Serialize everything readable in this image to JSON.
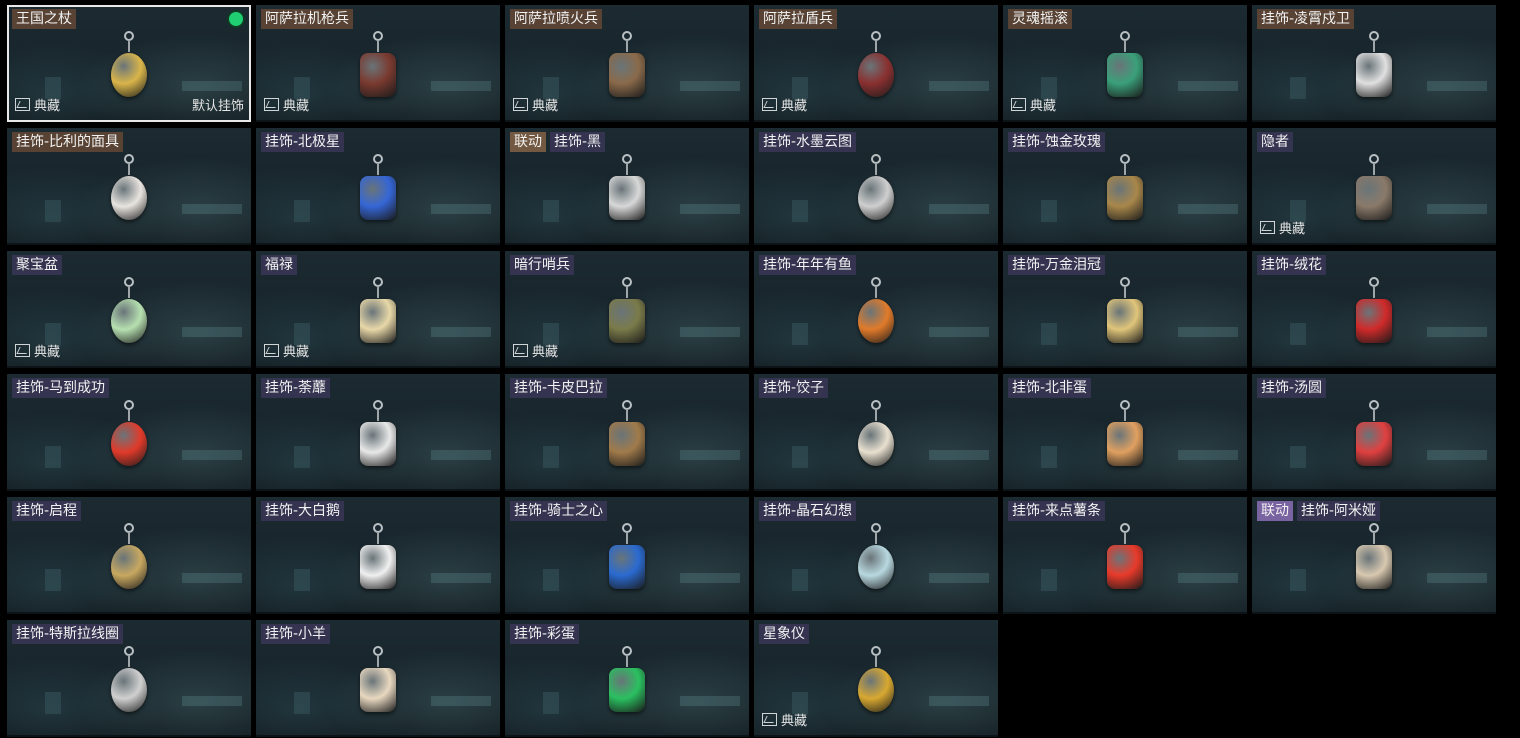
{
  "charms": [
    {
      "name": "王国之杖",
      "name_style": "orange",
      "collection": "典藏",
      "default_label": "默认挂饰",
      "selected": true,
      "equipped": true,
      "icon": "golden-castle-scepter",
      "color": "#d9b54a"
    },
    {
      "name": "阿萨拉机枪兵",
      "name_style": "orange",
      "collection": "典藏",
      "icon": "machine-gunner-figure",
      "color": "#7a3a30"
    },
    {
      "name": "阿萨拉喷火兵",
      "name_style": "orange",
      "collection": "典藏",
      "icon": "flamethrower-figure",
      "color": "#8a6a4a"
    },
    {
      "name": "阿萨拉盾兵",
      "name_style": "orange",
      "collection": "典藏",
      "icon": "shield-soldier-figure",
      "color": "#8a3030"
    },
    {
      "name": "灵魂摇滚",
      "name_style": "orange",
      "collection": "典藏",
      "icon": "rock-guitarist-figure",
      "color": "#3aa07a"
    },
    {
      "name": "挂饰-凌霄戍卫",
      "name_style": "orange",
      "icon": "rocket-charm",
      "color": "#e0e0e0"
    },
    {
      "name": "挂饰-比利的面具",
      "name_style": "orange",
      "icon": "billy-mask-charm",
      "color": "#e8e4df"
    },
    {
      "name": "挂饰-北极星",
      "name_style": "purple",
      "icon": "polaris-blade-charm",
      "color": "#3566d6"
    },
    {
      "name": "挂饰-黑",
      "name_style": "purple",
      "link_tag": "联动",
      "link_style": "orange",
      "icon": "black-lighter-charm",
      "color": "#d8d8d8"
    },
    {
      "name": "挂饰-水墨云图",
      "name_style": "purple",
      "icon": "ink-cloud-ball-charm",
      "color": "#cfcfcf"
    },
    {
      "name": "挂饰-蚀金玫瑰",
      "name_style": "purple",
      "icon": "gold-rose-badge-charm",
      "color": "#a8874a"
    },
    {
      "name": "隐者",
      "name_style": "purple",
      "collection": "典藏",
      "icon": "hermit-card-charm",
      "color": "#8a7a6a"
    },
    {
      "name": "聚宝盆",
      "name_style": "purple",
      "collection": "典藏",
      "icon": "treasure-bowl-charm",
      "color": "#b6e0b0"
    },
    {
      "name": "福禄",
      "name_style": "purple",
      "collection": "典藏",
      "icon": "gourd-charm",
      "color": "#e8d8a8"
    },
    {
      "name": "暗行哨兵",
      "name_style": "purple",
      "collection": "典藏",
      "icon": "stealth-sentry-figure",
      "color": "#7a7a4a"
    },
    {
      "name": "挂饰-年年有鱼",
      "name_style": "purple",
      "icon": "fish-plate-charm",
      "color": "#e07a2a"
    },
    {
      "name": "挂饰-万金泪冠",
      "name_style": "purple",
      "icon": "gold-crown-charm",
      "color": "#e0c57a"
    },
    {
      "name": "挂饰-绒花",
      "name_style": "purple",
      "icon": "velvet-flower-charm",
      "color": "#d02a2a"
    },
    {
      "name": "挂饰-马到成功",
      "name_style": "purple",
      "icon": "red-horse-charm",
      "color": "#e03a2a"
    },
    {
      "name": "挂饰-荼蘼",
      "name_style": "purple",
      "icon": "white-flower-charm",
      "color": "#e8e8e8"
    },
    {
      "name": "挂饰-卡皮巴拉",
      "name_style": "purple",
      "icon": "capybara-charm",
      "color": "#a07a4a"
    },
    {
      "name": "挂饰-饺子",
      "name_style": "purple",
      "icon": "dumpling-plate-charm",
      "color": "#e8e0d0"
    },
    {
      "name": "挂饰-北非蛋",
      "name_style": "purple",
      "icon": "shakshuka-pan-charm",
      "color": "#e0a060"
    },
    {
      "name": "挂饰-汤圆",
      "name_style": "purple",
      "icon": "tangyuan-bowl-charm",
      "color": "#e04040"
    },
    {
      "name": "挂饰-启程",
      "name_style": "purple",
      "icon": "compass-medal-charm",
      "color": "#c8a860"
    },
    {
      "name": "挂饰-大白鹅",
      "name_style": "purple",
      "icon": "white-goose-charm",
      "color": "#f0f0f0"
    },
    {
      "name": "挂饰-骑士之心",
      "name_style": "purple",
      "icon": "blue-cross-emblem-charm",
      "color": "#2a6ad0"
    },
    {
      "name": "挂饰-晶石幻想",
      "name_style": "purple",
      "icon": "crystal-cube-charm",
      "color": "#b8d8e0"
    },
    {
      "name": "挂饰-来点薯条",
      "name_style": "purple",
      "icon": "french-fries-charm",
      "color": "#e83a2a"
    },
    {
      "name": "挂饰-阿米娅",
      "name_style": "purple",
      "link_tag": "联动",
      "link_style": "purple",
      "icon": "amiya-rabbit-charm",
      "color": "#d8c8b0"
    },
    {
      "name": "挂饰-特斯拉线圈",
      "name_style": "purple",
      "icon": "tesla-coil-charm",
      "color": "#d0d0d0"
    },
    {
      "name": "挂饰-小羊",
      "name_style": "purple",
      "icon": "lamb-charm",
      "color": "#e8d8c0"
    },
    {
      "name": "挂饰-彩蛋",
      "name_style": "purple",
      "icon": "green-egg-charm",
      "color": "#2ac060"
    },
    {
      "name": "星象仪",
      "name_style": "purple",
      "collection": "典藏",
      "icon": "astrolabe-charm",
      "color": "#d8a830"
    }
  ]
}
